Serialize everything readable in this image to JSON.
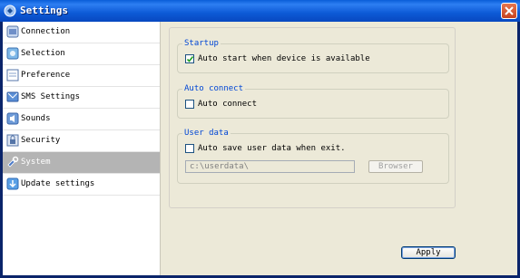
{
  "window": {
    "title": "Settings"
  },
  "sidebar": {
    "items": [
      {
        "label": "Connection",
        "icon": "connection-icon"
      },
      {
        "label": "Selection",
        "icon": "selection-icon"
      },
      {
        "label": "Preference",
        "icon": "preference-icon"
      },
      {
        "label": "SMS Settings",
        "icon": "sms-icon"
      },
      {
        "label": "Sounds",
        "icon": "sounds-icon"
      },
      {
        "label": "Security",
        "icon": "security-icon"
      },
      {
        "label": "System",
        "icon": "system-icon",
        "selected": true
      },
      {
        "label": "Update settings",
        "icon": "update-icon"
      }
    ]
  },
  "startup": {
    "legend": "Startup",
    "auto_start_label": "Auto start when device is available",
    "auto_start_checked": true
  },
  "auto_connect": {
    "legend": "Auto connect",
    "auto_connect_label": "Auto connect",
    "auto_connect_checked": false
  },
  "user_data": {
    "legend": "User data",
    "auto_save_label": "Auto save user data when exit.",
    "auto_save_checked": false,
    "path_value": "c:\\userdata\\",
    "browse_label": "Browser"
  },
  "apply_label": "Apply",
  "colors": {
    "titlebar": "#0a5ed8",
    "selected_item": "#b4b4b4",
    "group_legend": "#0046d5",
    "client_bg": "#ece9d8"
  }
}
